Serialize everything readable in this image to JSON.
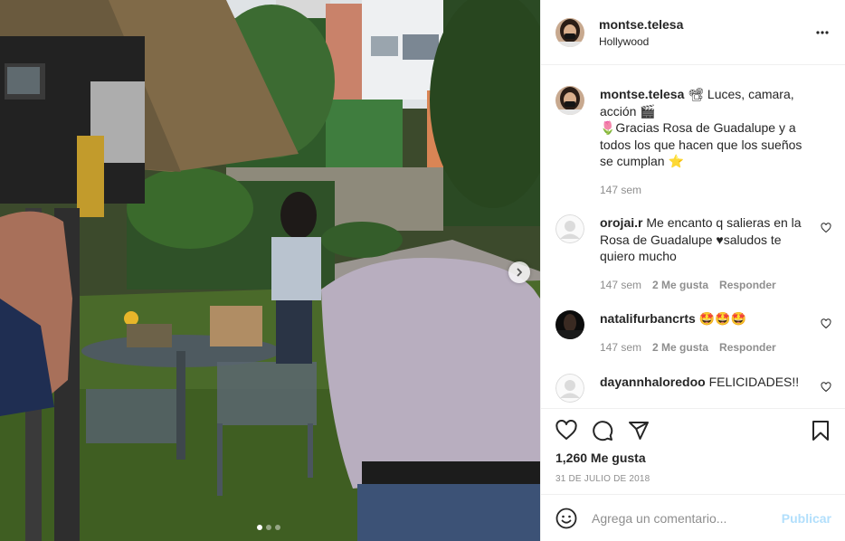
{
  "post": {
    "username": "montse.telesa",
    "location": "Hollywood",
    "more_icon": "more-horizontal-icon"
  },
  "caption": {
    "username": "montse.telesa",
    "line1": "📽 Luces, camara, acción 🎬",
    "line2": "🌷Gracias Rosa de Guadalupe y a todos los que hacen que los sueños se cumplan ⭐",
    "time": "147 sem"
  },
  "comments": [
    {
      "username": "orojai.r",
      "text": "Me encanto q salieras en la Rosa de Guadalupe ♥saludos te quiero mucho",
      "time": "147 sem",
      "likes": "2 Me gusta",
      "reply": "Responder"
    },
    {
      "username": "natalifurbancrts",
      "text": "🤩🤩🤩",
      "time": "147 sem",
      "likes": "2 Me gusta",
      "reply": "Responder"
    },
    {
      "username": "dayannhaloredoo",
      "text": "FELICIDADES!!"
    }
  ],
  "actions": {
    "likes_count": "1,260 Me gusta",
    "date": "31 DE JULIO DE 2018"
  },
  "add_comment": {
    "placeholder": "Agrega un comentario...",
    "publish": "Publicar"
  },
  "carousel": {
    "current": 1,
    "total": 3
  },
  "colors": {
    "text": "#262626",
    "secondary": "#8e8e8e",
    "border": "#efefef",
    "publish_disabled": "#b2dffc"
  }
}
